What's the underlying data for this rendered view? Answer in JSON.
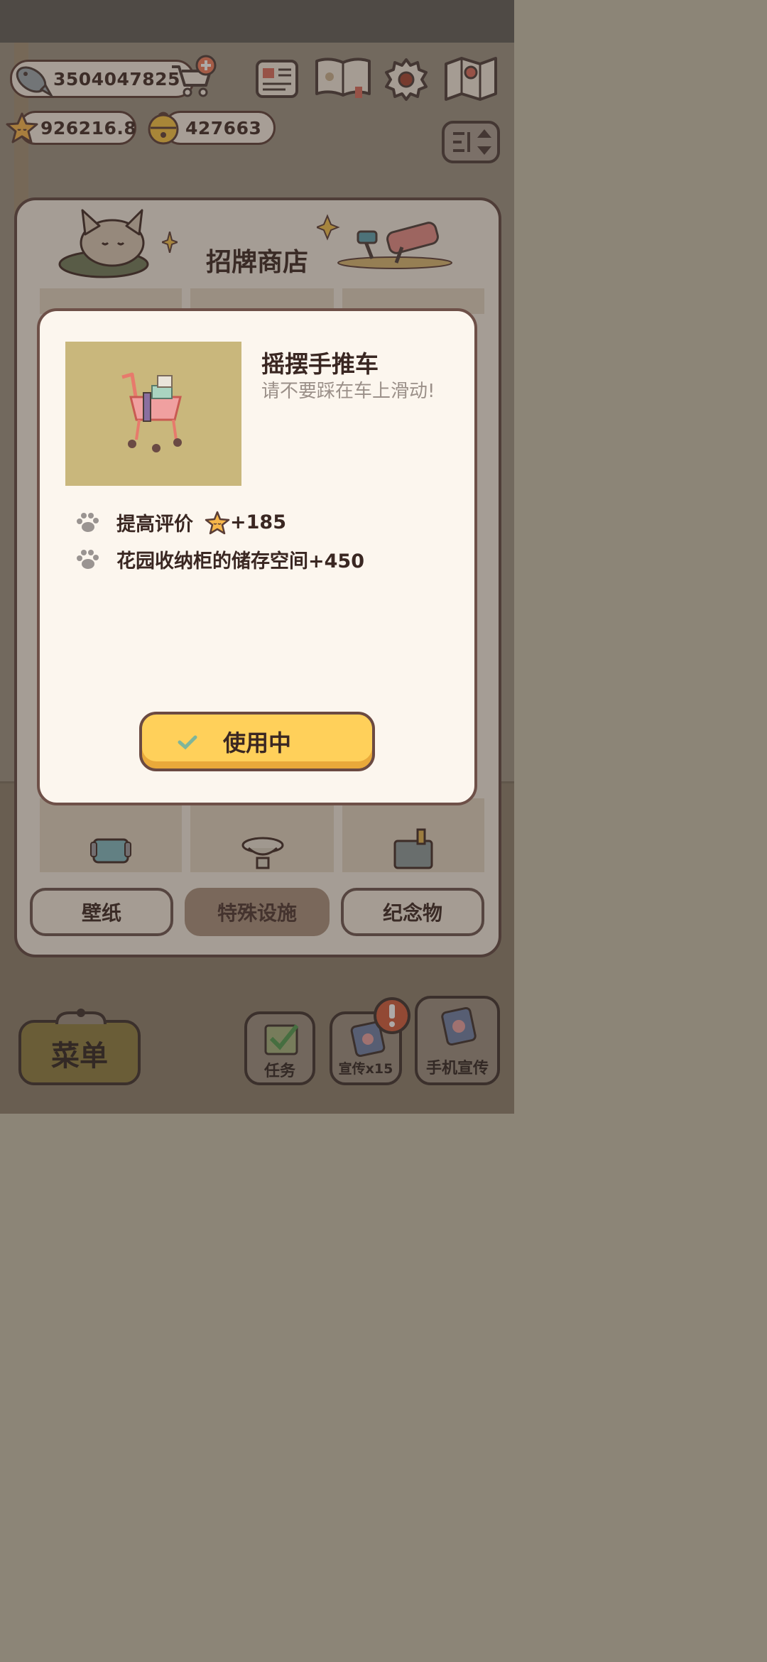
{
  "hud": {
    "fish_value": "3504047825",
    "star_value": "926216.8",
    "bell_value": "427663",
    "icons": [
      "fish-icon",
      "cart-plus-icon",
      "star-icon",
      "bell-icon",
      "newspaper-icon",
      "paw-book-icon",
      "gear-icon",
      "map-icon",
      "sort-toggle-icon"
    ]
  },
  "shop": {
    "title": "招牌商店",
    "tabs": [
      {
        "label": "壁纸",
        "active": false
      },
      {
        "label": "特殊设施",
        "active": true
      },
      {
        "label": "纪念物",
        "active": false
      }
    ]
  },
  "detail": {
    "item_name": "摇摆手推车",
    "item_desc": "请不要踩在车上滑动!",
    "effects": [
      {
        "label": "提高评价",
        "value": "+185",
        "icon": "star-icon"
      },
      {
        "label": "花园收纳柜的储存空间+450"
      }
    ],
    "use_button_label": "使用中"
  },
  "bottom": {
    "menu_label": "菜单",
    "tasks_label": "任务",
    "promo_label": "宣传x15",
    "phone_promo_label": "手机宣传"
  },
  "colors": {
    "accent_yellow": "#ffd05a",
    "outline_brown": "#5d4540",
    "card_bg": "#fcf6ee"
  }
}
